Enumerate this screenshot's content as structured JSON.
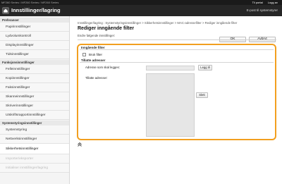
{
  "topbar": {
    "product": "MF260 Series / MF260 Series / MF260 Series",
    "portal_link": "Til portal",
    "logout_link": "Logg av"
  },
  "header": {
    "title": "Innstillinger/lagring",
    "email_link": "E-post til systemstyrer"
  },
  "sidebar": {
    "sections": [
      {
        "heading": "Preferanser",
        "items": [
          "Papirinnstillinger",
          "Lydvolumkontroll",
          "Displayinnstillinger",
          "Tidsinnstillinger"
        ]
      },
      {
        "heading": "Funksjonsinnstillinger",
        "items": [
          "Felleinnstillinger",
          "Kopiinnstillinger",
          "Faksinnstillinger",
          "Skanneinnstillinger",
          "Skriverinnstillinger",
          "Utskriftsrapportinnstillinger"
        ]
      },
      {
        "heading": "Systemstyringsinnstillinger",
        "items": [
          "Systemstyring",
          "Nettverksinnstillinger",
          "Sikkerhetsinnstillinger",
          "Importer/eksporter",
          "Initialiser innstillinger/lagring"
        ]
      }
    ],
    "active_item": "Sikkerhetsinnstillinger"
  },
  "main": {
    "breadcrumb": "Innstillinger/lagring : Systemstyringsinnstillinger > Sikkerhetsinnstillinger > MAC-adressefilter > Rediger inngående filter",
    "heading": "Rediger inngående filter",
    "hint": "Endre følgende innstillinger:",
    "ok_label": "OK",
    "cancel_label": "Avbryt",
    "panel": {
      "title": "Inngående filter",
      "use_filter_label": "Bruk filter",
      "use_filter_checked": false,
      "allowed_section_title": "Tillatte adresser",
      "address_to_add_label": "Adresse som skal legges:",
      "address_to_add_value": "",
      "add_button": "Legg til",
      "allowed_addresses_label": "Tillatte adresser:",
      "allowed_addresses": [],
      "delete_button": "Slett"
    }
  },
  "colors": {
    "highlight_frame": "#f29f1f",
    "header_bg": "#262626"
  }
}
